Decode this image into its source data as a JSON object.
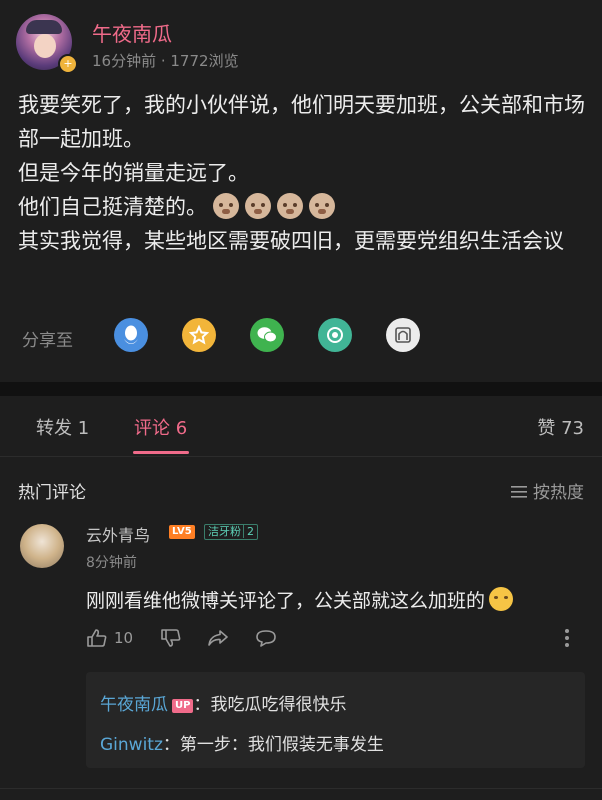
{
  "post": {
    "author": "午夜南瓜",
    "meta": "16分钟前 · 1772浏览",
    "lines": [
      "我要笑死了，我的小伙伴说，他们明天要加班，公关部和市场部一起加班。",
      "但是今年的销量走远了。",
      "他们自己挺清楚的。",
      "其实我觉得，某些地区需要破四旧，更需要党组织生活会议"
    ],
    "emoji_icons": [
      "dog-face-icon",
      "dog-face-icon",
      "dog-face-icon",
      "dog-face-icon"
    ],
    "share_label": "分享至",
    "share_targets": [
      {
        "icon": "qq-icon",
        "color": "#4a8fe0"
      },
      {
        "icon": "qzone-star-icon",
        "color": "#f2b53a"
      },
      {
        "icon": "wechat-icon",
        "color": "#3fb34f"
      },
      {
        "icon": "moments-icon",
        "color": "#41b596"
      },
      {
        "icon": "card-share-icon",
        "color": "#ececec"
      }
    ]
  },
  "tabs": {
    "repost": "转发 1",
    "comments": "评论 6",
    "likes": "赞 73"
  },
  "comments_section": {
    "title": "热门评论",
    "sort_label": "按热度"
  },
  "comment": {
    "user": "云外青鸟",
    "level_badge": "LV5",
    "fan_badge": "洁牙粉",
    "fan_level": "2",
    "time": "8分钟前",
    "text": "刚刚看维他微博关评论了，公关部就这么加班的",
    "emoji_icon": "cat-face-icon",
    "like_count": "10",
    "replies": [
      {
        "name": "午夜南瓜",
        "badge": "UP",
        "text": "：我吃瓜吃得很快乐"
      },
      {
        "name": "Ginwitz",
        "badge": "",
        "text": "：第一步：我们假装无事发生"
      }
    ]
  },
  "colors": {
    "accent": "#f06b8a",
    "link": "#5aa7d6",
    "background": "#1e1e1e"
  }
}
